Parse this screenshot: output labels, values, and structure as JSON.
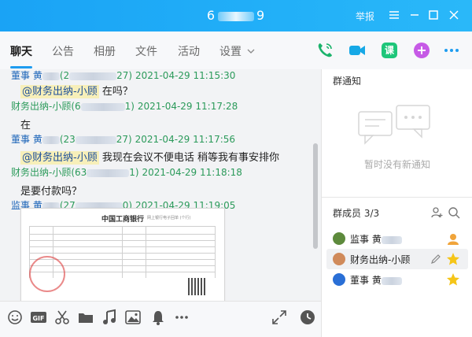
{
  "window": {
    "title_prefix": "6",
    "title_suffix": "9",
    "report_label": "举报"
  },
  "toolbar": {
    "tabs": [
      {
        "label": "聊天"
      },
      {
        "label": "公告"
      },
      {
        "label": "相册"
      },
      {
        "label": "文件"
      },
      {
        "label": "活动"
      },
      {
        "label": "设置"
      }
    ],
    "app_icon_label": "课"
  },
  "messages": [
    {
      "sender": "董事 黄",
      "id_pre": "(2",
      "id_suf": "27)",
      "time": "2021-04-29 11:15:30",
      "mention": "@财务出纳-小顾",
      "text": " 在吗？"
    },
    {
      "sender": "财务出纳-小顾",
      "id_pre": "(6",
      "id_suf": "1)",
      "time": "2021-04-29 11:17:28",
      "mention": "",
      "text": "在"
    },
    {
      "sender": "董事 黄",
      "id_pre": "(23",
      "id_suf": "27)",
      "time": "2021-04-29 11:17:56",
      "mention": "@财务出纳-小顾",
      "text": " 我现在会议不便电话 稍等我有事安排你"
    },
    {
      "sender": "财务出纳-小顾",
      "id_pre": "(63",
      "id_suf": "1)",
      "time": "2021-04-29 11:18:18",
      "mention": "",
      "text": "是要付款吗？"
    },
    {
      "sender": "监事 黄",
      "id_pre": "(27",
      "id_suf": "0)",
      "time": "2021-04-29 11:19:05",
      "mention": "",
      "text": ""
    }
  ],
  "receipt": {
    "bank": "中国工商银行",
    "sub": "网上银行电子回单 (个行)"
  },
  "sidebar": {
    "notice_title": "群通知",
    "notice_empty": "暂时没有新通知",
    "members_title": "群成员 3/3",
    "members": [
      {
        "name": "监事 黄",
        "role_color": "#f0a43a"
      },
      {
        "name": "财务出纳-小顾",
        "role_color": "#f5c518"
      },
      {
        "name": "董事 黄",
        "role_color": "#f5c518"
      }
    ]
  },
  "colors": {
    "accent": "#1e9cf0",
    "titlebar": "#22b0f8",
    "sender_blue": "#1a63b8",
    "meta_green": "#2b9a5a",
    "mention_bg": "#f7efb9"
  }
}
